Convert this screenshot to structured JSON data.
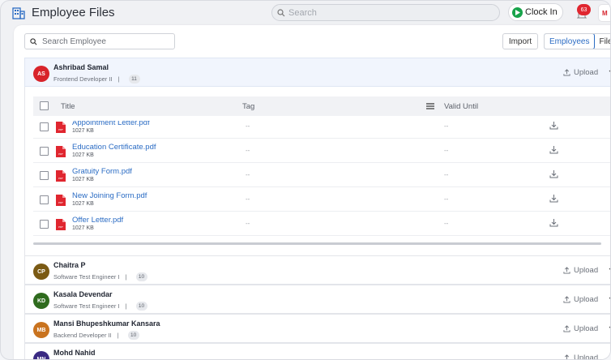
{
  "app": {
    "title": "Employee Files"
  },
  "header": {
    "search_placeholder": "Search",
    "clock_label": "Clock In",
    "notification_count": "63",
    "user_initial": "M"
  },
  "toolbar": {
    "employee_search_placeholder": "Search Employee",
    "import_label": "Import",
    "view_active": "Employees",
    "view_other": "File"
  },
  "table": {
    "headers": {
      "title": "Title",
      "tag": "Tag",
      "valid_until": "Valid Until"
    },
    "rows": [
      {
        "name": "Appointment Letter.pdf",
        "size": "1027 KB",
        "tag": "--",
        "valid": "--"
      },
      {
        "name": "Education Certificate.pdf",
        "size": "1027 KB",
        "tag": "--",
        "valid": "--"
      },
      {
        "name": "Gratuity Form.pdf",
        "size": "1027 KB",
        "tag": "--",
        "valid": "--"
      },
      {
        "name": "New Joining Form.pdf",
        "size": "1027 KB",
        "tag": "--",
        "valid": "--"
      },
      {
        "name": "Offer Letter.pdf",
        "size": "1027 KB",
        "tag": "--",
        "valid": "--"
      }
    ]
  },
  "employees": [
    {
      "initials": "AS",
      "name": "Ashribad Samal",
      "role": "Frontend Developer II",
      "count": "11",
      "upload": "Upload",
      "color": "#d8232a"
    },
    {
      "initials": "CP",
      "name": "Chaitra P",
      "role": "Software Test Engineer I",
      "count": "10",
      "upload": "Upload",
      "color": "#7a5a14"
    },
    {
      "initials": "KD",
      "name": "Kasala Devendar",
      "role": "Software Test Engineer I",
      "count": "10",
      "upload": "Upload",
      "color": "#2f6b1e"
    },
    {
      "initials": "MB",
      "name": "Mansi Bhupeshkumar Kansara",
      "role": "Backend Developer II",
      "count": "10",
      "upload": "Upload",
      "color": "#c9731f"
    },
    {
      "initials": "MN",
      "name": "Mohd Nahid",
      "role": "",
      "count": "",
      "upload": "Upload",
      "color": "#3a2a82"
    }
  ],
  "colors": {
    "accent": "#2b6cc4",
    "pdf": "#e0262f",
    "clock": "#17a34a"
  }
}
